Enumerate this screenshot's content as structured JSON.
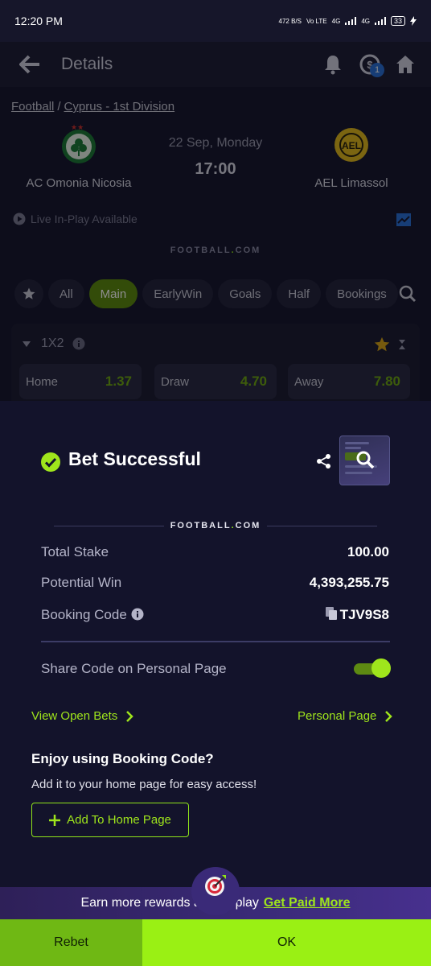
{
  "status_bar": {
    "time": "12:20 PM",
    "net_speed": "472 B/S",
    "vo": "Vo LTE",
    "sig1": "4G",
    "sig2": "4G",
    "battery": "33"
  },
  "header": {
    "title": "Details",
    "notification_badge": "1"
  },
  "breadcrumb": {
    "sport": "Football",
    "separator": "/",
    "league": "Cyprus - 1st Division"
  },
  "match": {
    "home_team": "AC Omonia Nicosia",
    "away_team": "AEL Limassol",
    "date": "22 Sep, Monday",
    "time": "17:00",
    "live_text": "Live In-Play Available"
  },
  "brand": {
    "name_left": "FOOTBALL",
    "dot": ".",
    "name_right": "COM"
  },
  "tabs": [
    "All",
    "Main",
    "EarlyWin",
    "Goals",
    "Half",
    "Bookings"
  ],
  "market": {
    "title": "1X2",
    "odds": [
      {
        "label": "Home",
        "value": "1.37"
      },
      {
        "label": "Draw",
        "value": "4.70"
      },
      {
        "label": "Away",
        "value": "7.80"
      }
    ]
  },
  "sheet": {
    "title": "Bet Successful",
    "total_stake_label": "Total Stake",
    "total_stake_value": "100.00",
    "potential_win_label": "Potential Win",
    "potential_win_value": "4,393,255.75",
    "booking_code_label": "Booking Code",
    "booking_code_value": "TJV9S8",
    "share_label": "Share Code on Personal Page",
    "share_enabled": true,
    "view_open_bets": "View Open Bets",
    "personal_page": "Personal Page",
    "promo_title": "Enjoy using Booking Code?",
    "promo_sub": "Add it to your home page for easy access!",
    "add_button": "Add To Home Page"
  },
  "banner": {
    "text": "Earn more rewards as you play",
    "link": "Get Paid More"
  },
  "bottom": {
    "rebet": "Rebet",
    "ok": "OK"
  },
  "colors": {
    "accent": "#9fe51c",
    "sheet_bg": "#13132b",
    "odd_value": "#6fa814"
  }
}
